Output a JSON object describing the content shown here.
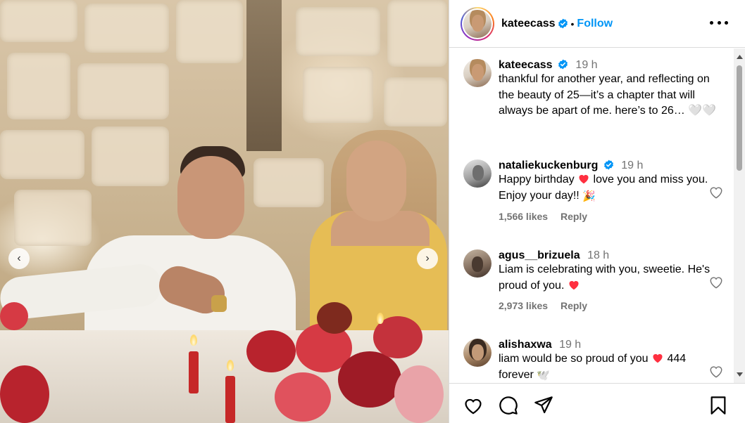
{
  "post": {
    "author": "kateecass",
    "follow_label": "Follow",
    "separator": "•"
  },
  "photo": {
    "description_icons": [
      "chevron-left-icon",
      "chevron-right-icon"
    ]
  },
  "caption": {
    "username": "kateecass",
    "time": "19 h",
    "text": "thankful for another year, and reflecting on the beauty of 25—it’s a chapter that will always be apart of me. here’s to 26… 🤍🤍"
  },
  "comments": [
    {
      "username": "nataliekuckenburg",
      "verified": true,
      "time": "19 h",
      "text_a": "Happy birthday",
      "text_b": "love you and miss you. Enjoy your day!!",
      "emoji": "🎉",
      "likes": "1,566 likes",
      "reply": "Reply"
    },
    {
      "username": "agus__brizuela",
      "verified": false,
      "time": "18 h",
      "text_a": "Liam is celebrating with you, sweetie. He's proud of you.",
      "likes": "2,973 likes",
      "reply": "Reply"
    },
    {
      "username": "alishaxwa",
      "verified": false,
      "time": "19 h",
      "text_a": "liam would be so proud of you",
      "text_b": "444 forever",
      "emoji": "🕊️"
    }
  ],
  "colors": {
    "accent": "#0095f6",
    "verified": "#0095f6",
    "heart": "#ff3040",
    "muted": "#737373",
    "border": "#dbdbdb"
  },
  "icons": {
    "actions": [
      "heart-icon",
      "comment-icon",
      "share-icon",
      "bookmark-icon"
    ]
  }
}
